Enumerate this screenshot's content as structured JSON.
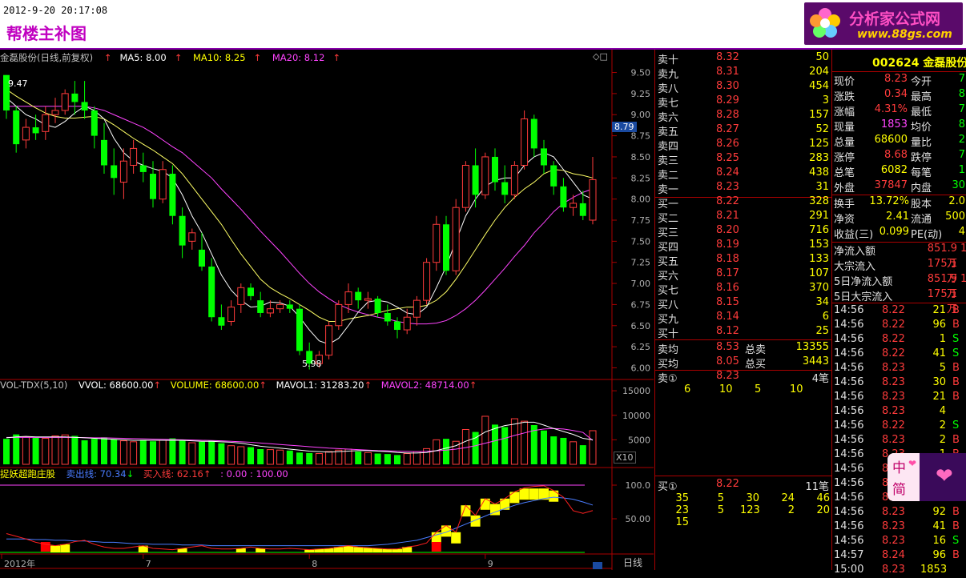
{
  "header": {
    "datetime": "2012-9-20 20:17:08",
    "title": "帮楼主补图",
    "logo_name": "分析家公式网",
    "logo_url": "www.88gs.com"
  },
  "main_chart": {
    "legend": {
      "stock": "金磊股份(日线,前复权)",
      "ma5": "MA5: 8.00",
      "ma10": "MA10: 8.25",
      "ma20": "MA20: 8.12"
    },
    "high_label": "9.47",
    "low_label": "5.98",
    "current_price_tag": "8.79",
    "y_ticks": [
      "9.50",
      "9.25",
      "9.00",
      "8.75",
      "8.50",
      "8.25",
      "8.00",
      "7.75",
      "7.50",
      "7.25",
      "7.00",
      "6.75",
      "6.50",
      "6.25",
      "6.00"
    ],
    "colors": {
      "up": "#ff3b3b",
      "down": "#00ff00",
      "ma5": "#ffffff",
      "ma10": "#ffff66",
      "ma20": "#ff44ff"
    }
  },
  "chart_data": [
    {
      "type": "candlestick",
      "title": "金磊股份(日线,前复权)",
      "ylim": [
        5.9,
        9.6
      ],
      "series_names": [
        "MA5",
        "MA10",
        "MA20"
      ],
      "ohlc": [
        [
          9.47,
          9.47,
          8.95,
          9.05
        ],
        [
          9.05,
          9.1,
          8.55,
          8.65
        ],
        [
          8.7,
          8.95,
          8.6,
          8.85
        ],
        [
          8.85,
          9.0,
          8.7,
          8.78
        ],
        [
          8.8,
          9.1,
          8.7,
          9.0
        ],
        [
          9.0,
          9.2,
          8.9,
          9.05
        ],
        [
          9.05,
          9.3,
          9.0,
          9.25
        ],
        [
          9.25,
          9.4,
          9.0,
          9.15
        ],
        [
          9.15,
          9.4,
          8.95,
          9.05
        ],
        [
          9.05,
          9.1,
          8.6,
          8.75
        ],
        [
          8.7,
          8.9,
          8.3,
          8.4
        ],
        [
          8.4,
          8.6,
          8.05,
          8.25
        ],
        [
          8.2,
          8.6,
          8.0,
          8.45
        ],
        [
          8.4,
          8.7,
          8.3,
          8.6
        ],
        [
          8.4,
          8.55,
          8.2,
          8.32
        ],
        [
          8.3,
          8.45,
          7.9,
          8.0
        ],
        [
          8.0,
          8.45,
          7.95,
          8.35
        ],
        [
          8.3,
          8.4,
          7.7,
          7.8
        ],
        [
          7.8,
          7.9,
          7.3,
          7.45
        ],
        [
          7.5,
          7.65,
          7.4,
          7.6
        ],
        [
          7.4,
          7.6,
          7.15,
          7.2
        ],
        [
          7.2,
          7.3,
          6.55,
          6.6
        ],
        [
          6.6,
          6.75,
          6.45,
          6.5
        ],
        [
          6.55,
          6.8,
          6.5,
          6.72
        ],
        [
          6.75,
          7.0,
          6.65,
          6.95
        ],
        [
          6.95,
          7.0,
          6.8,
          6.85
        ],
        [
          6.8,
          6.9,
          6.6,
          6.65
        ],
        [
          6.65,
          6.8,
          6.6,
          6.7
        ],
        [
          6.7,
          6.8,
          6.65,
          6.75
        ],
        [
          6.75,
          6.8,
          6.65,
          6.7
        ],
        [
          6.7,
          6.75,
          6.15,
          6.2
        ],
        [
          6.2,
          6.3,
          5.98,
          6.05
        ],
        [
          6.05,
          6.2,
          6.0,
          6.15
        ],
        [
          6.15,
          6.55,
          6.1,
          6.5
        ],
        [
          6.5,
          6.8,
          6.45,
          6.75
        ],
        [
          6.75,
          7.0,
          6.65,
          6.9
        ],
        [
          6.9,
          6.95,
          6.7,
          6.8
        ],
        [
          6.8,
          6.9,
          6.7,
          6.82
        ],
        [
          6.82,
          6.85,
          6.6,
          6.65
        ],
        [
          6.65,
          6.75,
          6.5,
          6.55
        ],
        [
          6.55,
          6.6,
          6.35,
          6.45
        ],
        [
          6.45,
          6.7,
          6.4,
          6.6
        ],
        [
          6.6,
          6.85,
          6.5,
          6.8
        ],
        [
          6.8,
          7.3,
          6.75,
          7.25
        ],
        [
          7.25,
          7.8,
          7.15,
          7.7
        ],
        [
          7.7,
          7.8,
          7.1,
          7.15
        ],
        [
          7.15,
          8.0,
          7.1,
          7.9
        ],
        [
          7.9,
          8.45,
          7.85,
          8.4
        ],
        [
          8.4,
          8.6,
          7.9,
          8.05
        ],
        [
          8.05,
          8.55,
          8.0,
          8.5
        ],
        [
          8.5,
          8.6,
          8.1,
          8.2
        ],
        [
          8.2,
          8.4,
          7.95,
          8.05
        ],
        [
          8.05,
          8.45,
          8.0,
          8.4
        ],
        [
          8.4,
          9.05,
          8.35,
          8.95
        ],
        [
          8.95,
          9.0,
          8.5,
          8.6
        ],
        [
          8.6,
          8.7,
          8.3,
          8.4
        ],
        [
          8.4,
          8.45,
          8.05,
          8.15
        ],
        [
          8.15,
          8.25,
          7.85,
          7.9
        ],
        [
          7.9,
          8.05,
          7.8,
          7.95
        ],
        [
          7.95,
          8.1,
          7.75,
          7.8
        ],
        [
          7.75,
          8.5,
          7.7,
          8.23
        ]
      ],
      "ma5": [
        9.2,
        9.1,
        9.0,
        8.95,
        8.88,
        8.85,
        8.92,
        9.02,
        9.1,
        9.05,
        8.95,
        8.72,
        8.55,
        8.45,
        8.4,
        8.36,
        8.33,
        8.25,
        8.05,
        7.8,
        7.6,
        7.35,
        7.1,
        6.92,
        6.8,
        6.72,
        6.73,
        6.78,
        6.77,
        6.73,
        6.6,
        6.45,
        6.32,
        6.28,
        6.35,
        6.5,
        6.66,
        6.78,
        6.8,
        6.78,
        6.72,
        6.65,
        6.63,
        6.72,
        6.95,
        7.2,
        7.5,
        7.8,
        8.0,
        8.15,
        8.22,
        8.25,
        8.25,
        8.4,
        8.5,
        8.55,
        8.5,
        8.35,
        8.2,
        8.05,
        8.0
      ],
      "ma10": [
        9.3,
        9.22,
        9.15,
        9.08,
        9.02,
        8.98,
        8.96,
        8.96,
        8.97,
        8.98,
        8.95,
        8.88,
        8.8,
        8.72,
        8.65,
        8.58,
        8.5,
        8.42,
        8.3,
        8.15,
        8.0,
        7.85,
        7.7,
        7.52,
        7.35,
        7.2,
        7.05,
        6.95,
        6.88,
        6.82,
        6.75,
        6.68,
        6.6,
        6.55,
        6.55,
        6.58,
        6.6,
        6.62,
        6.65,
        6.68,
        6.7,
        6.72,
        6.72,
        6.74,
        6.8,
        6.9,
        7.05,
        7.22,
        7.4,
        7.58,
        7.75,
        7.9,
        8.02,
        8.12,
        8.2,
        8.3,
        8.35,
        8.34,
        8.3,
        8.28,
        8.25
      ],
      "ma20": [
        9.1,
        9.1,
        9.1,
        9.1,
        9.1,
        9.1,
        9.1,
        9.1,
        9.1,
        9.08,
        9.05,
        9.0,
        8.95,
        8.9,
        8.85,
        8.78,
        8.7,
        8.62,
        8.55,
        8.45,
        8.35,
        8.25,
        8.12,
        8.0,
        7.88,
        7.75,
        7.62,
        7.5,
        7.38,
        7.25,
        7.12,
        7.0,
        6.9,
        6.82,
        6.75,
        6.7,
        6.66,
        6.63,
        6.6,
        6.58,
        6.55,
        6.53,
        6.52,
        6.52,
        6.53,
        6.56,
        6.62,
        6.7,
        6.8,
        6.92,
        7.05,
        7.18,
        7.32,
        7.45,
        7.6,
        7.72,
        7.85,
        7.95,
        8.02,
        8.08,
        8.12
      ]
    },
    {
      "type": "bar",
      "title": "VOL-TDX(5,10)",
      "ylim": [
        0,
        16000
      ],
      "series_names": [
        "VOLUME",
        "MAVOL1",
        "MAVOL2"
      ],
      "volume": [
        5200,
        6100,
        5600,
        5400,
        5300,
        5800,
        6000,
        5800,
        4900,
        5200,
        5500,
        5100,
        4800,
        4600,
        5000,
        4700,
        4900,
        5300,
        5000,
        4400,
        4600,
        4900,
        4300,
        3800,
        3600,
        3500,
        3100,
        3000,
        2900,
        2800,
        2400,
        2300,
        2200,
        2600,
        2900,
        3100,
        2600,
        2400,
        2200,
        2100,
        1900,
        2200,
        2600,
        3200,
        5000,
        5200,
        4700,
        7100,
        6600,
        9800,
        8100,
        7600,
        9300,
        8800,
        8000,
        6900,
        5700,
        5400,
        4600,
        3900,
        6860
      ],
      "mavol1": [
        5400,
        5600,
        5700,
        5600,
        5600,
        5600,
        5600,
        5500,
        5400,
        5300,
        5200,
        5100,
        5000,
        4900,
        4900,
        4900,
        4900,
        4900,
        4900,
        4800,
        4700,
        4700,
        4600,
        4500,
        4300,
        4000,
        3700,
        3500,
        3300,
        3100,
        2900,
        2700,
        2600,
        2500,
        2600,
        2700,
        2800,
        2800,
        2700,
        2600,
        2400,
        2300,
        2300,
        2400,
        2800,
        3300,
        3800,
        4700,
        5400,
        6600,
        7300,
        7900,
        8200,
        8600,
        8600,
        8000,
        7300,
        6700,
        6100,
        5300,
        5008
      ],
      "mavol2": [
        5500,
        5500,
        5500,
        5500,
        5500,
        5500,
        5500,
        5500,
        5450,
        5400,
        5400,
        5350,
        5300,
        5250,
        5200,
        5150,
        5100,
        5050,
        5000,
        4950,
        4900,
        4850,
        4800,
        4700,
        4600,
        4500,
        4350,
        4200,
        4050,
        3900,
        3750,
        3600,
        3450,
        3300,
        3200,
        3100,
        3000,
        2900,
        2800,
        2750,
        2700,
        2650,
        2600,
        2650,
        2750,
        2900,
        3100,
        3400,
        3800,
        4300,
        4800,
        5300,
        5900,
        6400,
        6900,
        7200,
        7300,
        7200,
        6900,
        6500,
        4871
      ]
    },
    {
      "type": "line",
      "title": "捉妖超跑庄股",
      "ylim": [
        0,
        100
      ],
      "series_names": [
        "卖出线",
        "买入线"
      ],
      "sell_line": [
        20,
        20,
        20,
        19,
        19,
        18,
        18,
        17,
        17,
        16,
        15,
        15,
        14,
        13,
        13,
        12,
        12,
        12,
        11,
        11,
        11,
        10,
        10,
        10,
        10,
        10,
        10,
        10,
        10,
        10,
        10,
        10,
        10,
        10,
        10,
        10,
        10,
        10,
        11,
        12,
        14,
        16,
        18,
        22,
        26,
        30,
        36,
        42,
        48,
        54,
        60,
        65,
        70,
        74,
        77,
        80,
        82,
        81,
        79,
        75,
        70.34
      ],
      "buy_line": [
        28,
        24,
        20,
        15,
        12,
        10,
        12,
        16,
        18,
        12,
        8,
        6,
        6,
        8,
        10,
        6,
        5,
        4,
        6,
        8,
        10,
        6,
        5,
        5,
        6,
        8,
        6,
        5,
        5,
        6,
        5,
        4,
        5,
        6,
        8,
        10,
        8,
        7,
        6,
        5,
        5,
        8,
        10,
        14,
        30,
        40,
        30,
        70,
        55,
        80,
        72,
        80,
        90,
        96,
        98,
        99,
        92,
        82,
        62,
        58,
        62.16
      ],
      "buy_signal_indices": [
        5,
        6,
        14,
        18,
        24,
        26,
        31,
        32,
        33,
        34,
        35,
        36,
        37,
        38,
        39,
        40,
        41,
        44,
        45,
        46,
        47,
        48,
        49,
        50,
        51,
        52,
        53,
        54,
        55,
        56
      ],
      "red_signal_indices": [
        4,
        44
      ]
    }
  ],
  "vol_legend": {
    "name": "VOL-TDX(5,10)",
    "vvol": "VVOL: 68600.00",
    "volume": "VOLUME: 68600.00",
    "mavol1": "MAVOL1: 31283.20",
    "mavol2": "MAVOL2: 48714.00"
  },
  "vol_y_ticks": [
    "15000",
    "10000",
    "5000"
  ],
  "vol_unit": "X10",
  "ind_legend": {
    "name": "捉妖超跑庄股",
    "sell": "卖出线: 70.34",
    "buy": "买入线: 62.16",
    "range": ": 0.00 : 100.00"
  },
  "ind_y_ticks": [
    "100.0",
    "50.00"
  ],
  "x_labels": [
    "2012年",
    "7",
    "8",
    "9"
  ],
  "period_label": "日线",
  "order_book": {
    "sell": [
      {
        "label": "卖十",
        "price": "8.32",
        "vol": "50"
      },
      {
        "label": "卖九",
        "price": "8.31",
        "vol": "204"
      },
      {
        "label": "卖八",
        "price": "8.30",
        "vol": "454"
      },
      {
        "label": "卖七",
        "price": "8.29",
        "vol": "3"
      },
      {
        "label": "卖六",
        "price": "8.28",
        "vol": "157"
      },
      {
        "label": "卖五",
        "price": "8.27",
        "vol": "52"
      },
      {
        "label": "卖四",
        "price": "8.26",
        "vol": "125"
      },
      {
        "label": "卖三",
        "price": "8.25",
        "vol": "283"
      },
      {
        "label": "卖二",
        "price": "8.24",
        "vol": "438"
      },
      {
        "label": "卖一",
        "price": "8.23",
        "vol": "31"
      }
    ],
    "buy": [
      {
        "label": "买一",
        "price": "8.22",
        "vol": "328"
      },
      {
        "label": "买二",
        "price": "8.21",
        "vol": "291"
      },
      {
        "label": "买三",
        "price": "8.20",
        "vol": "716"
      },
      {
        "label": "买四",
        "price": "8.19",
        "vol": "153"
      },
      {
        "label": "买五",
        "price": "8.18",
        "vol": "133"
      },
      {
        "label": "买六",
        "price": "8.17",
        "vol": "107"
      },
      {
        "label": "买七",
        "price": "8.16",
        "vol": "370"
      },
      {
        "label": "买八",
        "price": "8.15",
        "vol": "34"
      },
      {
        "label": "买九",
        "price": "8.14",
        "vol": "6"
      },
      {
        "label": "买十",
        "price": "8.12",
        "vol": "25"
      }
    ],
    "sell_avg_label": "卖均",
    "sell_avg_price": "8.53",
    "sell_total_label": "总卖",
    "sell_total": "13355",
    "buy_avg_label": "买均",
    "buy_avg_price": "8.05",
    "buy_total_label": "总买",
    "buy_total": "3443",
    "ask1_label": "卖①",
    "ask1_price": "8.23",
    "ask1_count": "4笔",
    "ask1_queue": [
      "6",
      "10",
      "5",
      "10"
    ],
    "bid1_label": "买①",
    "bid1_price": "8.22",
    "bid1_count": "11笔",
    "bid1_queue": [
      [
        "35",
        "5",
        "30",
        "24",
        "46"
      ],
      [
        "23",
        "5",
        "123",
        "2",
        "20"
      ],
      [
        "15"
      ]
    ]
  },
  "quote": {
    "code_name": "002624 金磊股份",
    "rows": [
      {
        "l1": "现价",
        "v1": "8.23",
        "l2": "今开",
        "v2": "7"
      },
      {
        "l1": "涨跌",
        "v1": "0.34",
        "l2": "最高",
        "v2": "8"
      },
      {
        "l1": "涨幅",
        "v1": "4.31%",
        "l2": "最低",
        "v2": "7"
      },
      {
        "l1": "现量",
        "v1": "1853",
        "l2": "均价",
        "v2": "8"
      },
      {
        "l1": "总量",
        "v1": "68600",
        "l2": "量比",
        "v2": "2"
      },
      {
        "l1": "涨停",
        "v1": "8.68",
        "l2": "跌停",
        "v2": "7"
      },
      {
        "l1": "总笔",
        "v1": "6082",
        "l2": "每笔",
        "v2": "1"
      },
      {
        "l1": "外盘",
        "v1": "37847",
        "l2": "内盘",
        "v2": "30"
      }
    ],
    "rows2": [
      {
        "l1": "换手",
        "v1": "13.72%",
        "l2": "股本",
        "v2": "2.0"
      },
      {
        "l1": "净资",
        "v1": "2.41",
        "l2": "流通",
        "v2": "500"
      },
      {
        "l1": "收益(三)",
        "v1": "0.099",
        "l2": "PE(动)",
        "v2": "4"
      }
    ],
    "flows": [
      {
        "l": "净流入额",
        "v": "851.9万",
        "x": "1"
      },
      {
        "l": "大宗流入",
        "v": "175.1万",
        "x": ""
      },
      {
        "l": "5日净流入额",
        "v": "851.9万",
        "x": "1"
      },
      {
        "l": "5日大宗流入",
        "v": "175.1万",
        "x": ""
      }
    ],
    "ticks": [
      {
        "t": "14:56",
        "p": "8.22",
        "v": "21",
        "s": "B"
      },
      {
        "t": "14:56",
        "p": "8.22",
        "v": "96",
        "s": "B"
      },
      {
        "t": "14:56",
        "p": "8.22",
        "v": "1",
        "s": "S"
      },
      {
        "t": "14:56",
        "p": "8.22",
        "v": "41",
        "s": "S"
      },
      {
        "t": "14:56",
        "p": "8.23",
        "v": "5",
        "s": "B"
      },
      {
        "t": "14:56",
        "p": "8.23",
        "v": "30",
        "s": "B"
      },
      {
        "t": "14:56",
        "p": "8.23",
        "v": "21",
        "s": "B"
      },
      {
        "t": "14:56",
        "p": "8.23",
        "v": "4",
        "s": ""
      },
      {
        "t": "14:56",
        "p": "8.22",
        "v": "2",
        "s": "S"
      },
      {
        "t": "14:56",
        "p": "8.23",
        "v": "2",
        "s": "B"
      },
      {
        "t": "14:56",
        "p": "8.23",
        "v": "1",
        "s": "B"
      },
      {
        "t": "14:56",
        "p": "8.23",
        "v": "1",
        "s": "B"
      },
      {
        "t": "14:56",
        "p": "8.23",
        "v": "5",
        "s": "B"
      },
      {
        "t": "14:56",
        "p": "8.23",
        "v": "3",
        "s": "B"
      },
      {
        "t": "14:56",
        "p": "8.23",
        "v": "92",
        "s": "B"
      },
      {
        "t": "14:56",
        "p": "8.23",
        "v": "41",
        "s": "B"
      },
      {
        "t": "14:56",
        "p": "8.23",
        "v": "16",
        "s": "S"
      },
      {
        "t": "14:57",
        "p": "8.24",
        "v": "96",
        "s": "B"
      },
      {
        "t": "15:00",
        "p": "8.23",
        "v": "1853",
        "s": ""
      }
    ]
  },
  "float_widget": {
    "line1": "中",
    "line2": "简"
  }
}
